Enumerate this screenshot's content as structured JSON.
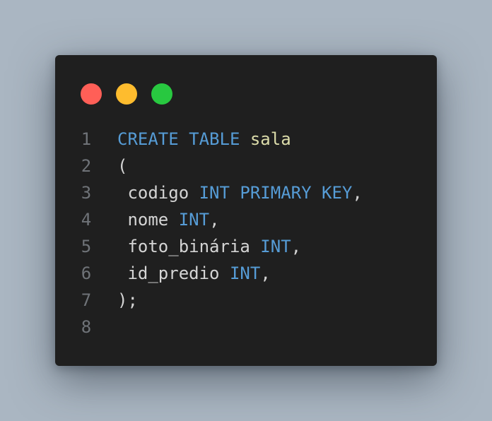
{
  "window_controls": {
    "close_color": "#ff5f57",
    "minimize_color": "#febc2e",
    "maximize_color": "#28c840"
  },
  "colors": {
    "background": "#aab6c2",
    "editor": "#1f1f1f",
    "keyword": "#569cd6",
    "identifier": "#dcdcaa",
    "text": "#d4d4d4",
    "line_number": "#6f7378"
  },
  "code": {
    "lines": [
      {
        "number": "1",
        "tokens": [
          {
            "text": "CREATE",
            "type": "kw"
          },
          {
            "text": " ",
            "type": "txt"
          },
          {
            "text": "TABLE",
            "type": "kw"
          },
          {
            "text": " ",
            "type": "txt"
          },
          {
            "text": "sala",
            "type": "id"
          }
        ]
      },
      {
        "number": "2",
        "tokens": [
          {
            "text": "(",
            "type": "txt"
          }
        ]
      },
      {
        "number": "3",
        "tokens": [
          {
            "text": " codigo ",
            "type": "txt"
          },
          {
            "text": "INT",
            "type": "kw"
          },
          {
            "text": " ",
            "type": "txt"
          },
          {
            "text": "PRIMARY",
            "type": "kw"
          },
          {
            "text": " ",
            "type": "txt"
          },
          {
            "text": "KEY",
            "type": "kw"
          },
          {
            "text": ",",
            "type": "txt"
          }
        ]
      },
      {
        "number": "4",
        "tokens": [
          {
            "text": " nome ",
            "type": "txt"
          },
          {
            "text": "INT",
            "type": "kw"
          },
          {
            "text": ",",
            "type": "txt"
          }
        ]
      },
      {
        "number": "5",
        "tokens": [
          {
            "text": " foto_binária ",
            "type": "txt"
          },
          {
            "text": "INT",
            "type": "kw"
          },
          {
            "text": ",",
            "type": "txt"
          }
        ]
      },
      {
        "number": "6",
        "tokens": [
          {
            "text": " id_predio ",
            "type": "txt"
          },
          {
            "text": "INT",
            "type": "kw"
          },
          {
            "text": ",",
            "type": "txt"
          }
        ]
      },
      {
        "number": "7",
        "tokens": [
          {
            "text": ");",
            "type": "txt"
          }
        ]
      },
      {
        "number": "8",
        "tokens": []
      }
    ]
  }
}
